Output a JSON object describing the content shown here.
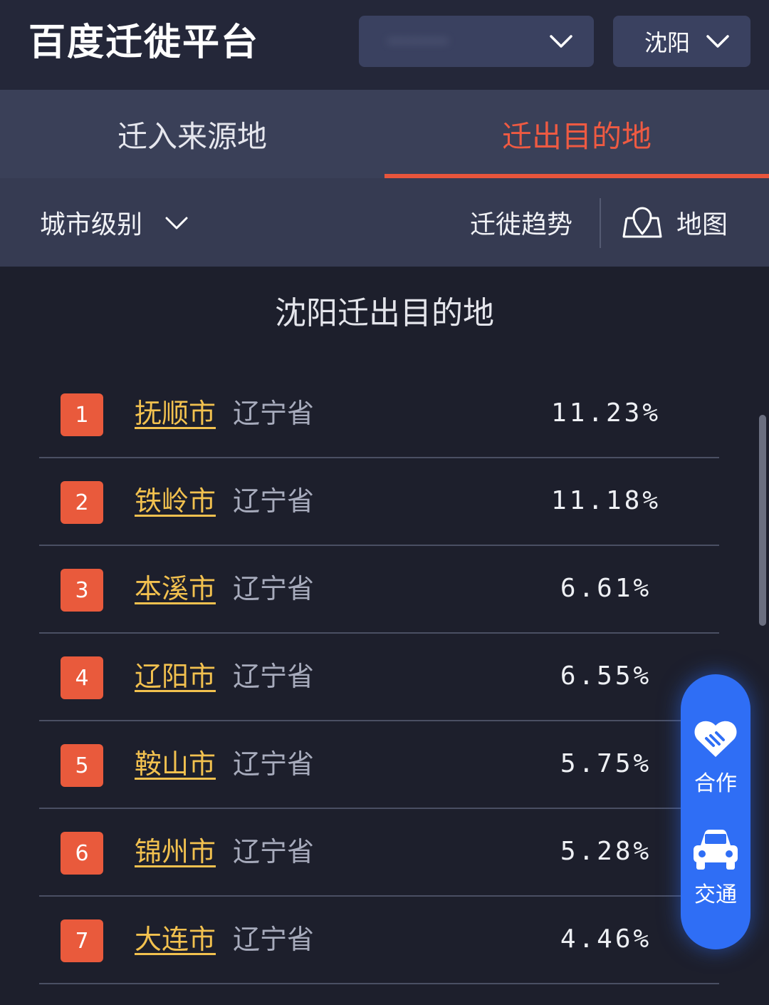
{
  "header": {
    "logo": "百度迁徙平台",
    "city_select": "沈阳",
    "blurred_select": "·········"
  },
  "tabs": [
    {
      "label": "迁入来源地",
      "active": false
    },
    {
      "label": "迁出目的地",
      "active": true
    }
  ],
  "filters": {
    "city_level": "城市级别",
    "trend": "迁徙趋势",
    "map": "地图"
  },
  "list": {
    "title": "沈阳迁出目的地",
    "rows": [
      {
        "rank": "1",
        "city": "抚顺市",
        "province": "辽宁省",
        "percent": "11.23%"
      },
      {
        "rank": "2",
        "city": "铁岭市",
        "province": "辽宁省",
        "percent": "11.18%"
      },
      {
        "rank": "3",
        "city": "本溪市",
        "province": "辽宁省",
        "percent": "6.61%"
      },
      {
        "rank": "4",
        "city": "辽阳市",
        "province": "辽宁省",
        "percent": "6.55%"
      },
      {
        "rank": "5",
        "city": "鞍山市",
        "province": "辽宁省",
        "percent": "5.75%"
      },
      {
        "rank": "6",
        "city": "锦州市",
        "province": "辽宁省",
        "percent": "5.28%"
      },
      {
        "rank": "7",
        "city": "大连市",
        "province": "辽宁省",
        "percent": "4.46%"
      }
    ]
  },
  "fab": {
    "cooperate": "合作",
    "traffic": "交通"
  },
  "colors": {
    "accent": "#e8553c",
    "city_link": "#f2c14f",
    "fab_blue": "#2f6ef5"
  }
}
